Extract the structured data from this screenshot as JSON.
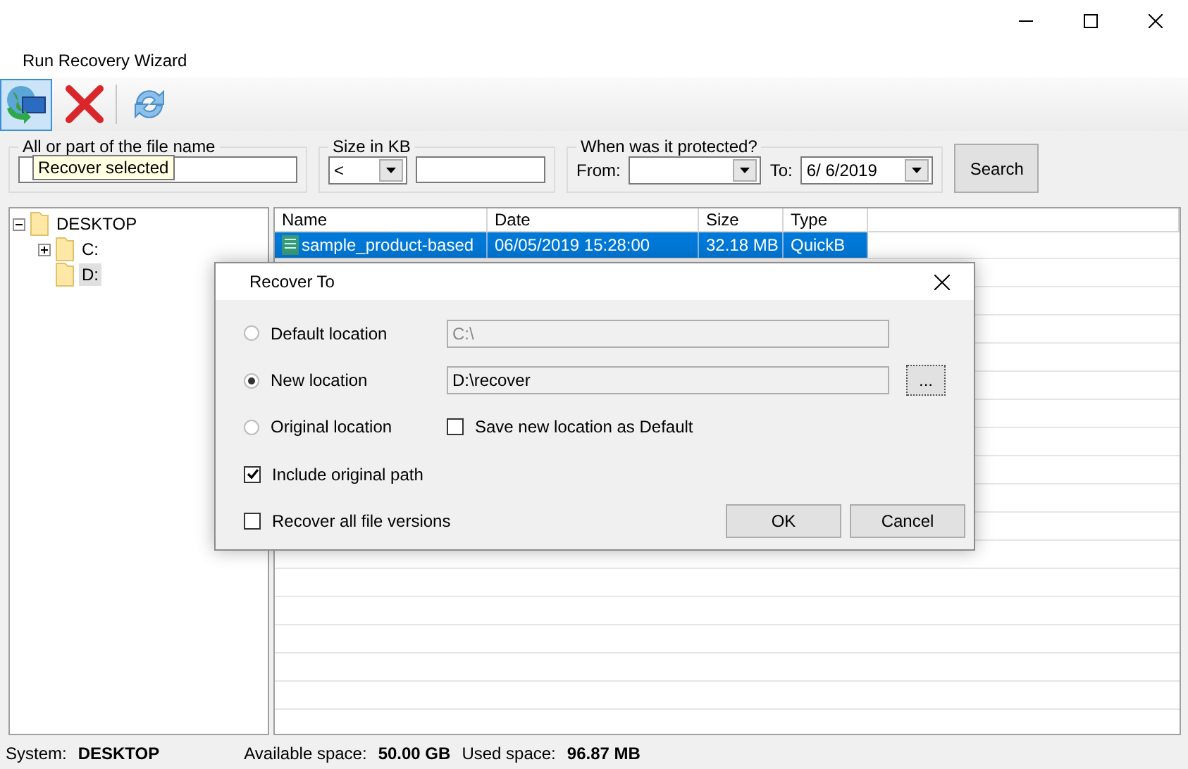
{
  "menu": [
    "Run Recovery Wizard"
  ],
  "toolbar": {
    "tooltip": "Recover selected"
  },
  "filters": {
    "name_legend": "All or part of the file name",
    "size_legend": "Size in KB",
    "size_operator": "<",
    "date_legend": "When was it protected?",
    "from_label": "From:",
    "to_label": "To:",
    "to_value": "6/ 6/2019",
    "search_button": "Search"
  },
  "tree": [
    {
      "label": "DESKTOP",
      "selected": false,
      "expanded": true,
      "children": [
        {
          "label": "C:",
          "selected": false,
          "expanded": false
        },
        {
          "label": "D:",
          "selected": true
        }
      ]
    }
  ],
  "table": {
    "columns": [
      "Name",
      "Date",
      "Size",
      "Type"
    ],
    "rows": [
      {
        "selected": true,
        "cells": [
          "sample_product-based",
          "06/05/2019 15:28:00",
          "32.18 MB",
          "QuickB"
        ]
      }
    ]
  },
  "dialog": {
    "title": "Recover To",
    "locations": [
      {
        "label": "Default location",
        "selected": false,
        "path": "C:\\",
        "disabled": true
      },
      {
        "label": "New location",
        "selected": true,
        "path": "D:\\recover",
        "disabled": false,
        "browse": "..."
      },
      {
        "label": "Original location",
        "selected": false,
        "option": {
          "label": "Save new location as Default",
          "checked": false
        }
      }
    ],
    "checks": [
      {
        "label": "Include original path",
        "checked": true
      },
      {
        "label": "Recover all file versions",
        "checked": false
      }
    ],
    "buttons": [
      "OK",
      "Cancel"
    ]
  },
  "status_bar": [
    {
      "label": "System:",
      "value": "DESKTOP"
    },
    {
      "label": "Available space:",
      "value": "50.00 GB"
    },
    {
      "label": "Used space:",
      "value": "96.87 MB"
    }
  ]
}
